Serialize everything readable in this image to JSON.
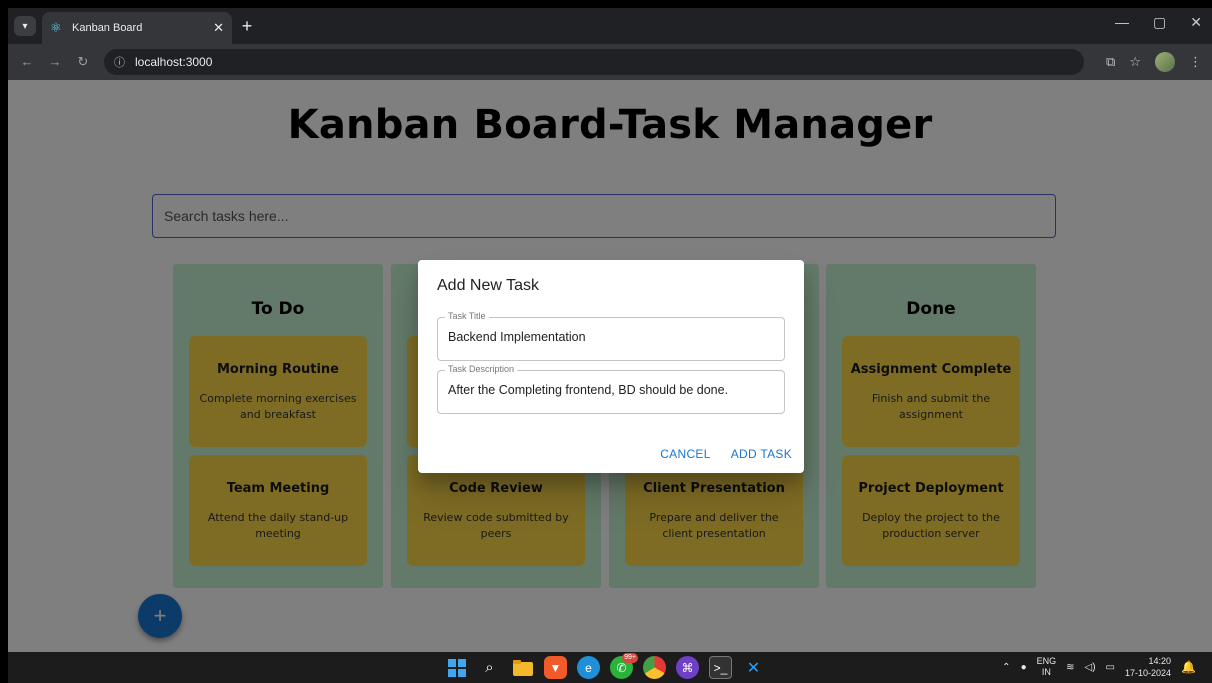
{
  "browser": {
    "tab_title": "Kanban Board",
    "tab_favicon": "react-icon",
    "new_tab_symbol": "+",
    "url": "localhost:3000",
    "window_controls": [
      "—",
      "▢",
      "✕"
    ]
  },
  "app": {
    "title": "Kanban Board-Task Manager",
    "search_placeholder": "Search tasks here...",
    "fab_symbol": "+"
  },
  "columns": [
    {
      "title": "To Do",
      "cards": [
        {
          "title": "Morning Routine",
          "description": "Complete morning exercises and breakfast"
        },
        {
          "title": "Team Meeting",
          "description": "Attend the daily stand-up meeting"
        }
      ]
    },
    {
      "title": "",
      "cards": [
        {
          "title": "",
          "description": ""
        },
        {
          "title": "Code Review",
          "description": "Review code submitted by peers"
        }
      ]
    },
    {
      "title": "",
      "cards": [
        {
          "title": "",
          "description": ""
        },
        {
          "title": "Client Presentation",
          "description": "Prepare and deliver the client presentation"
        }
      ]
    },
    {
      "title": "Done",
      "cards": [
        {
          "title": "Assignment Complete",
          "description": "Finish and submit the assignment"
        },
        {
          "title": "Project Deployment",
          "description": "Deploy the project to the production server"
        }
      ]
    }
  ],
  "dialog": {
    "title": "Add New Task",
    "task_title_label": "Task Title",
    "task_title_value": "Backend Implementation",
    "task_desc_label": "Task Description",
    "task_desc_value": "After the Completing frontend, BD should be done.",
    "cancel_label": "CANCEL",
    "add_label": "ADD TASK"
  },
  "taskbar": {
    "whatsapp_badge": "99+",
    "lang_top": "ENG",
    "lang_bottom": "IN",
    "time": "14:20",
    "date": "17-10-2024"
  },
  "colors": {
    "column_bg": "#c7f3d3",
    "card_bg": "#fcd84a",
    "accent": "#1976d2"
  }
}
